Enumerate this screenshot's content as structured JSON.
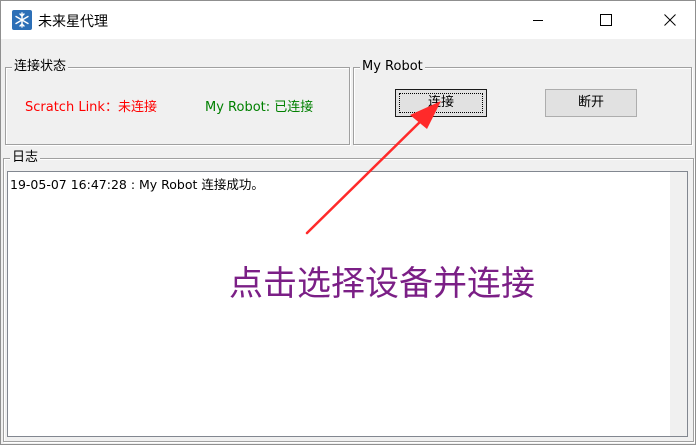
{
  "window": {
    "title": "未来星代理"
  },
  "status_group": {
    "label": "连接状态",
    "scratch_link": "Scratch Link：未连接",
    "robot": "My Robot: 已连接"
  },
  "robot_group": {
    "label": "My Robot",
    "connect_label": "连接",
    "disconnect_label": "断开"
  },
  "log_group": {
    "label": "日志",
    "lines": [
      "19-05-07 16:47:28 :   My Robot 连接成功。"
    ]
  },
  "annotation": {
    "text": "点击选择设备并连接",
    "color": "#7b1f86"
  },
  "colors": {
    "disconnected": "#ff0000",
    "connected": "#008000",
    "arrow": "#ff2a2a"
  },
  "icons": [
    "app-snowflake-icon",
    "minimize-icon",
    "maximize-icon",
    "close-icon"
  ]
}
